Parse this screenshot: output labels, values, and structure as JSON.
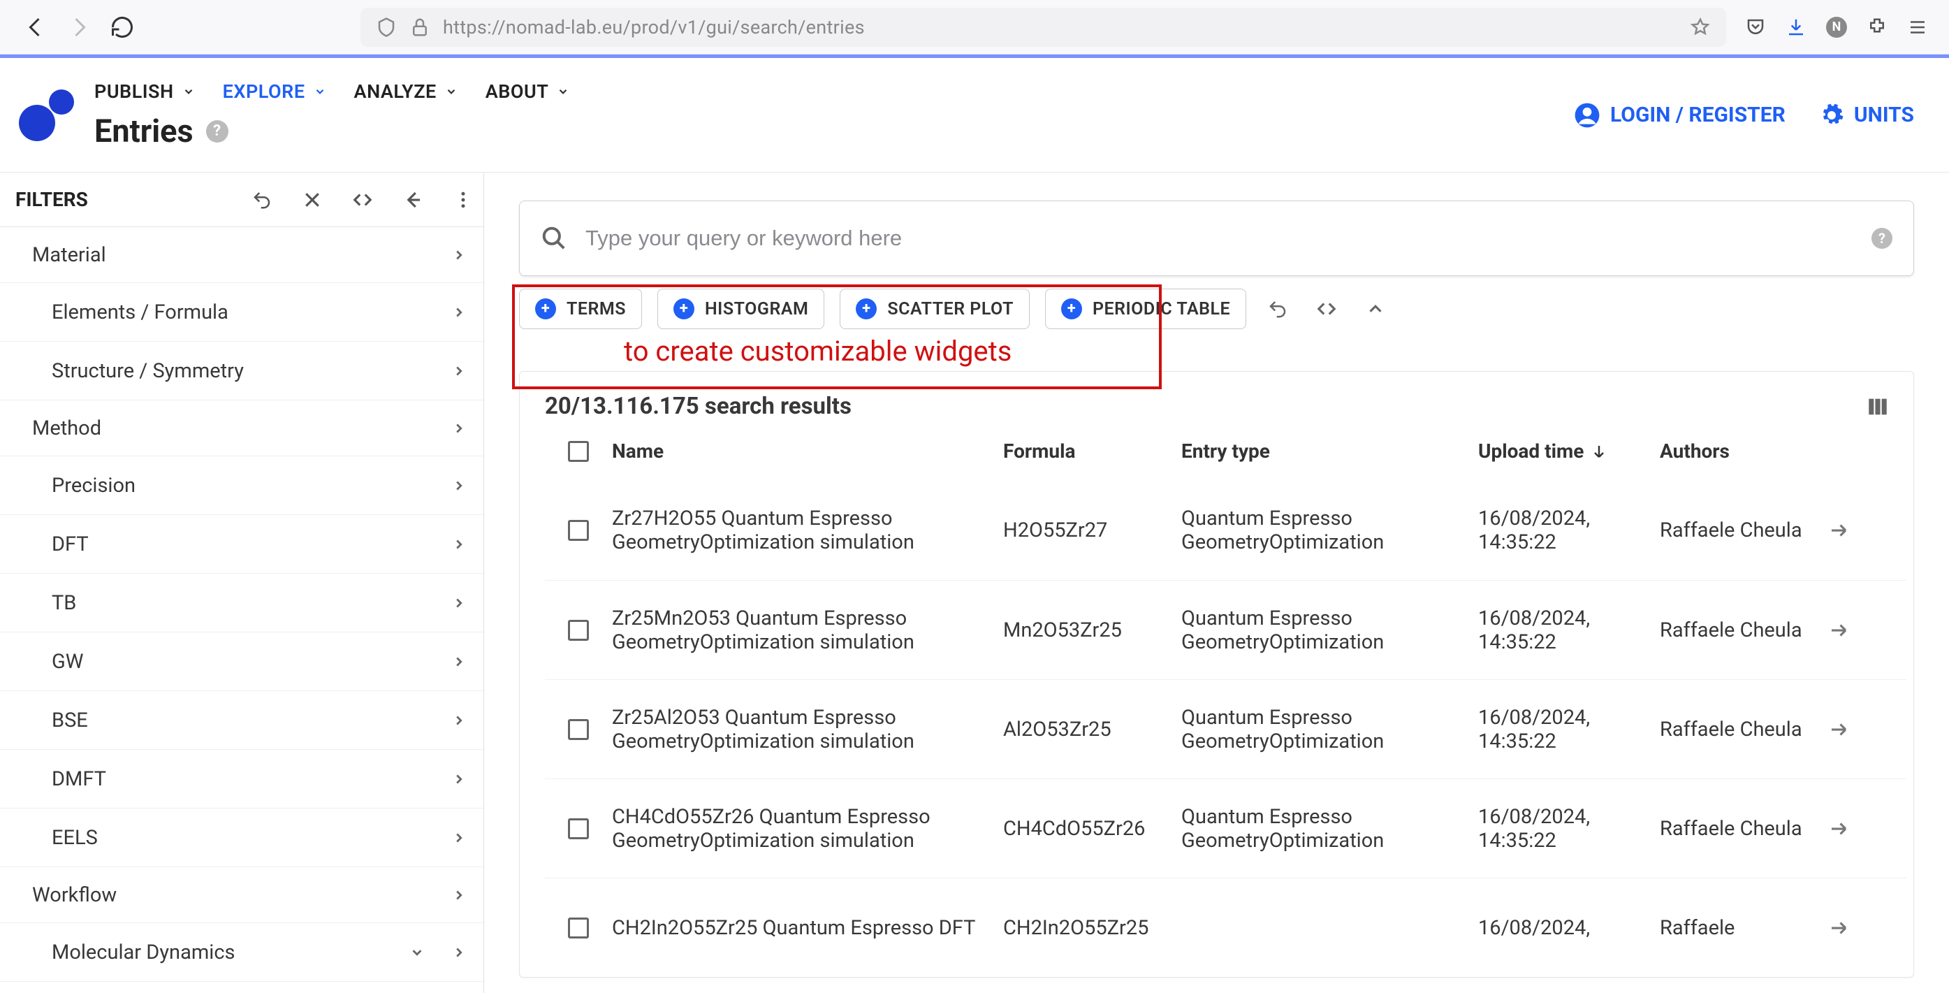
{
  "browser": {
    "url": "https://nomad-lab.eu/prod/v1/gui/search/entries"
  },
  "nav": {
    "publish": "PUBLISH",
    "explore": "EXPLORE",
    "analyze": "ANALYZE",
    "about": "ABOUT"
  },
  "page_title": "Entries",
  "login_label": "LOGIN / REGISTER",
  "units_label": "UNITS",
  "filters_title": "FILTERS",
  "sidebar": {
    "groups": [
      {
        "label": "Material",
        "type": "group"
      },
      {
        "label": "Elements / Formula",
        "type": "sub"
      },
      {
        "label": "Structure / Symmetry",
        "type": "sub"
      },
      {
        "label": "Method",
        "type": "group"
      },
      {
        "label": "Precision",
        "type": "sub"
      },
      {
        "label": "DFT",
        "type": "sub"
      },
      {
        "label": "TB",
        "type": "sub"
      },
      {
        "label": "GW",
        "type": "sub"
      },
      {
        "label": "BSE",
        "type": "sub"
      },
      {
        "label": "DMFT",
        "type": "sub"
      },
      {
        "label": "EELS",
        "type": "sub"
      },
      {
        "label": "Workflow",
        "type": "group"
      },
      {
        "label": "Molecular Dynamics",
        "type": "sub",
        "collapsed_icon": true
      }
    ]
  },
  "search_placeholder": "Type your query or keyword here",
  "widgets": {
    "terms": "TERMS",
    "histogram": "HISTOGRAM",
    "scatter": "SCATTER PLOT",
    "periodic": "PERIODIC TABLE"
  },
  "annotation": "to create customizable widgets",
  "results_summary": "20/13.116.175 search results",
  "columns": {
    "name": "Name",
    "formula": "Formula",
    "type": "Entry type",
    "time": "Upload time",
    "authors": "Authors"
  },
  "rows": [
    {
      "name": "Zr27H2O55 Quantum Espresso GeometryOptimization simulation",
      "formula": "H2O55Zr27",
      "type": "Quantum Espresso GeometryOptimization",
      "time": "16/08/2024, 14:35:22",
      "authors": "Raffaele Cheula"
    },
    {
      "name": "Zr25Mn2O53 Quantum Espresso GeometryOptimization simulation",
      "formula": "Mn2O53Zr25",
      "type": "Quantum Espresso GeometryOptimization",
      "time": "16/08/2024, 14:35:22",
      "authors": "Raffaele Cheula"
    },
    {
      "name": "Zr25Al2O53 Quantum Espresso GeometryOptimization simulation",
      "formula": "Al2O53Zr25",
      "type": "Quantum Espresso GeometryOptimization",
      "time": "16/08/2024, 14:35:22",
      "authors": "Raffaele Cheula"
    },
    {
      "name": "CH4CdO55Zr26 Quantum Espresso GeometryOptimization simulation",
      "formula": "CH4CdO55Zr26",
      "type": "Quantum Espresso GeometryOptimization",
      "time": "16/08/2024, 14:35:22",
      "authors": "Raffaele Cheula"
    },
    {
      "name": "CH2In2O55Zr25 Quantum Espresso DFT",
      "formula": "CH2In2O55Zr25",
      "type": "",
      "time": "16/08/2024,",
      "authors": "Raffaele"
    }
  ]
}
